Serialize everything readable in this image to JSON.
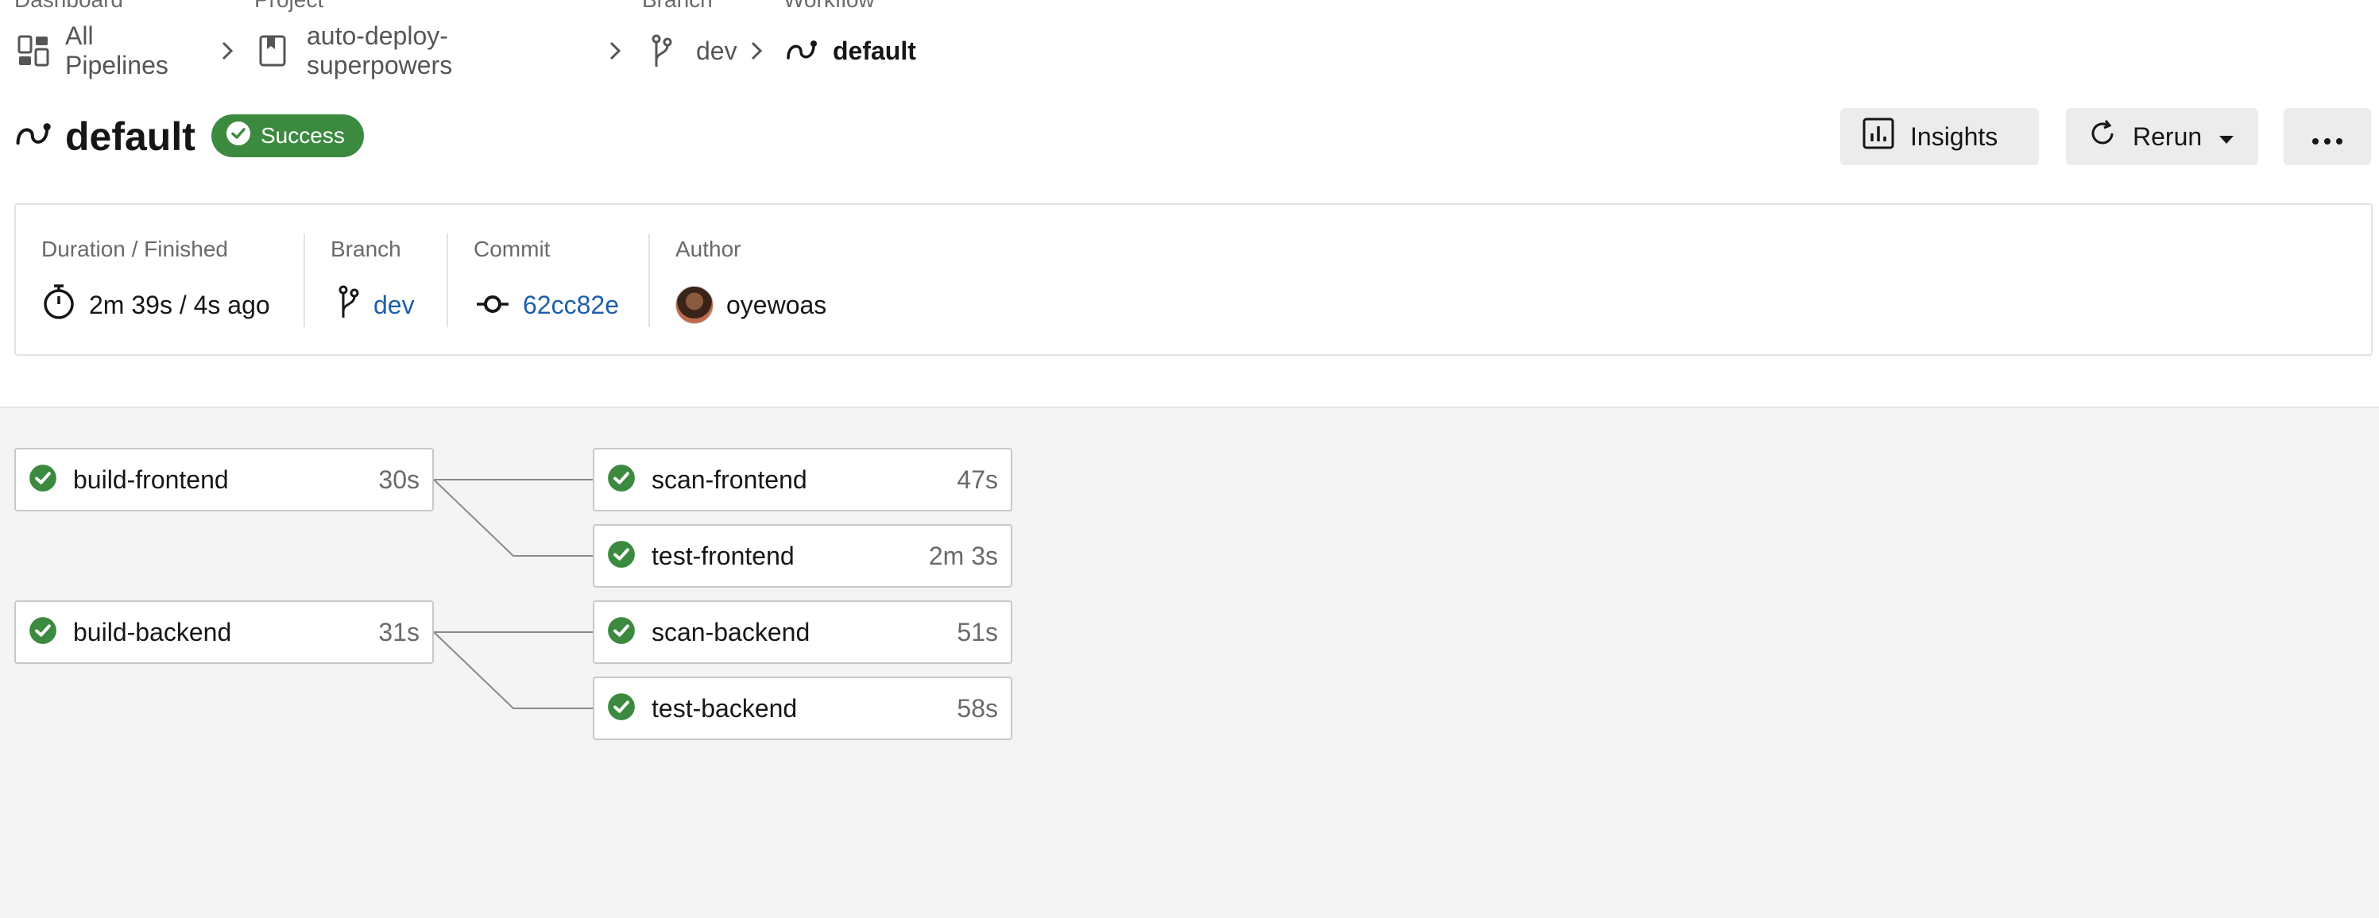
{
  "breadcrumb": {
    "labels": {
      "dashboard": "Dashboard",
      "project": "Project",
      "branch": "Branch",
      "workflow": "Workflow"
    },
    "items": {
      "all_pipelines": "All Pipelines",
      "project": "auto-deploy-superpowers",
      "branch": "dev",
      "workflow": "default"
    }
  },
  "header": {
    "title": "default",
    "status": "Success",
    "status_color": "#3b8a3f",
    "insights_label": "Insights",
    "rerun_label": "Rerun",
    "more_label": "•••"
  },
  "info": {
    "duration_label": "Duration / Finished",
    "duration_value": "2m 39s / 4s ago",
    "branch_label": "Branch",
    "branch_value": "dev",
    "commit_label": "Commit",
    "commit_value": "62cc82e",
    "author_label": "Author",
    "author_value": "oyewoas",
    "link_color": "#1d5fa8"
  },
  "jobs": {
    "build_frontend": {
      "name": "build-frontend",
      "duration": "30s",
      "status": "success"
    },
    "scan_frontend": {
      "name": "scan-frontend",
      "duration": "47s",
      "status": "success"
    },
    "test_frontend": {
      "name": "test-frontend",
      "duration": "2m 3s",
      "status": "success"
    },
    "build_backend": {
      "name": "build-backend",
      "duration": "31s",
      "status": "success"
    },
    "scan_backend": {
      "name": "scan-backend",
      "duration": "51s",
      "status": "success"
    },
    "test_backend": {
      "name": "test-backend",
      "duration": "58s",
      "status": "success"
    }
  },
  "icons": {
    "dashboard": "dashboard-icon",
    "project": "bookmark-icon",
    "branch": "branch-icon",
    "workflow": "workflow-icon",
    "success": "check-circle-icon",
    "insights": "bar-chart-icon",
    "rerun": "refresh-icon",
    "more": "ellipsis-icon",
    "duration": "stopwatch-icon",
    "commit": "commit-icon"
  }
}
